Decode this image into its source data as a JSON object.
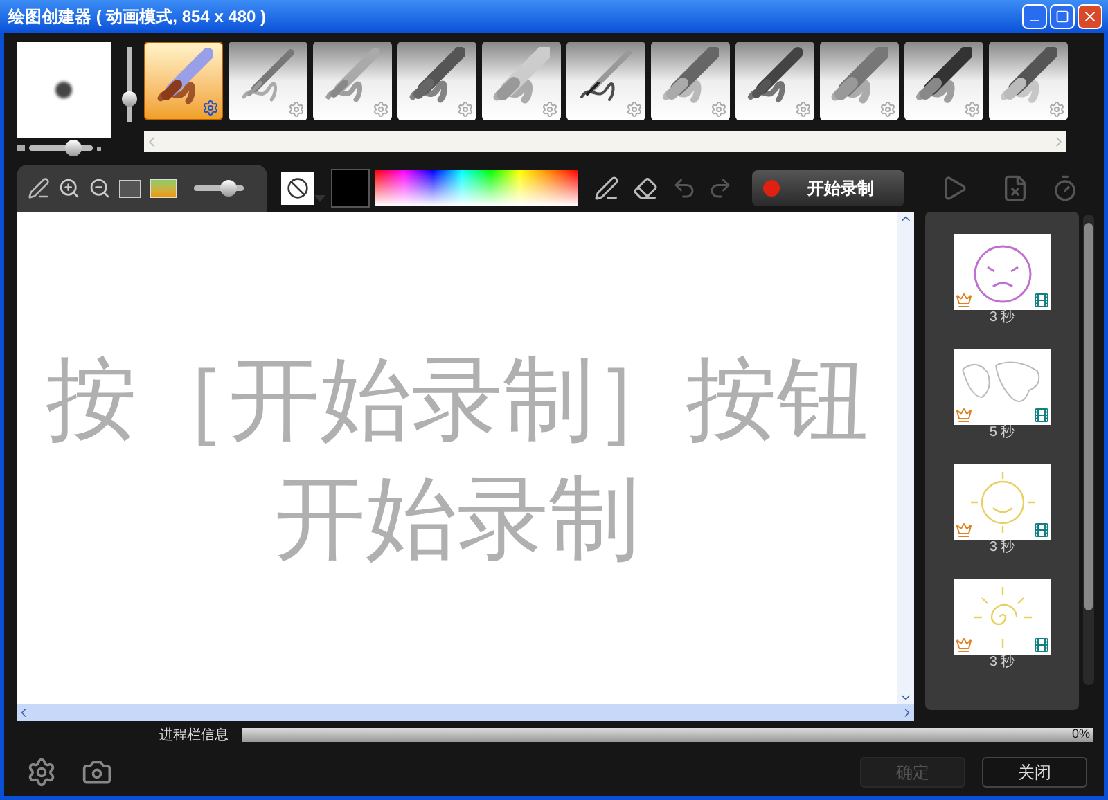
{
  "window": {
    "title": "绘图创建器 ( 动画模式, 854 x 480 )"
  },
  "brush_size": {
    "level": 0.7
  },
  "brush_opacity": {
    "level": 0.3
  },
  "brushes": [
    {
      "kind": "paintbrush",
      "selected": true
    },
    {
      "kind": "airbrush",
      "selected": false
    },
    {
      "kind": "crayon",
      "selected": false
    },
    {
      "kind": "chalk",
      "selected": false
    },
    {
      "kind": "charcoal",
      "selected": false
    },
    {
      "kind": "pencil",
      "selected": false
    },
    {
      "kind": "marker",
      "selected": false
    },
    {
      "kind": "felt",
      "selected": false
    },
    {
      "kind": "sponge",
      "selected": false
    },
    {
      "kind": "watercolor",
      "selected": false
    },
    {
      "kind": "blender",
      "selected": false
    }
  ],
  "zoom": {
    "level": 0.7
  },
  "record_button": {
    "label": "开始录制"
  },
  "canvas": {
    "lines": [
      "按［开始录制］按钮",
      "开始录制"
    ]
  },
  "frames": [
    {
      "kind": "face",
      "duration": "3 秒"
    },
    {
      "kind": "map",
      "duration": "5 秒"
    },
    {
      "kind": "smiling-sun",
      "duration": "3 秒"
    },
    {
      "kind": "spiral-sun",
      "duration": "3 秒"
    }
  ],
  "progress": {
    "label": "进程栏信息",
    "level": 0,
    "reading": "0%"
  },
  "buttons": [
    {
      "label": "确定",
      "disabled": true
    },
    {
      "label": "关闭",
      "disabled": false
    }
  ]
}
